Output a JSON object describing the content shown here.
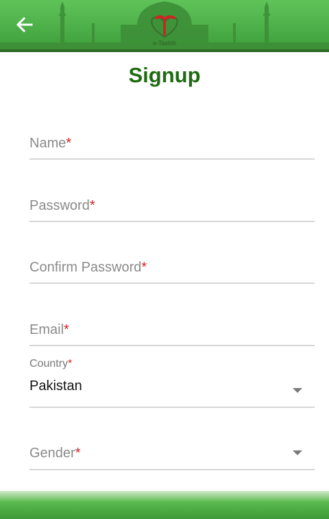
{
  "header": {
    "back_icon": "arrow-left-icon",
    "logo_text": "e-Tasbih",
    "color": "#4caf48"
  },
  "page": {
    "title": "Signup"
  },
  "form": {
    "required_mark": "*",
    "name": {
      "label": "Name"
    },
    "password": {
      "label": "Password"
    },
    "confirm_password": {
      "label": "Confirm Password"
    },
    "email": {
      "label": "Email"
    },
    "country": {
      "label": "Country",
      "value": "Pakistan"
    },
    "gender": {
      "label": "Gender"
    }
  },
  "colors": {
    "title": "#1e6b12",
    "required": "#d32222",
    "underline": "#d6d6d6"
  }
}
